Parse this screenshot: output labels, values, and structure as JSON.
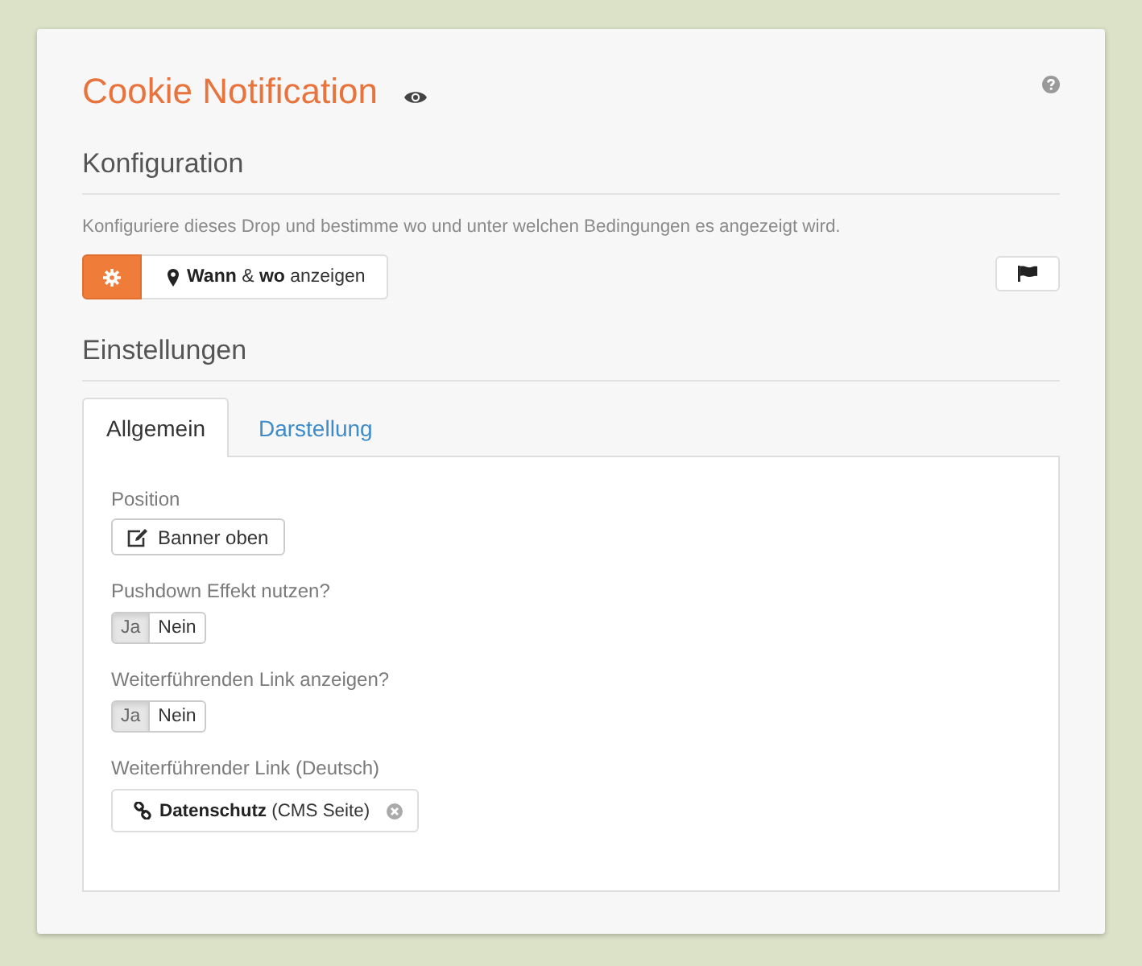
{
  "header": {
    "title": "Cookie Notification"
  },
  "configuration": {
    "heading": "Konfiguration",
    "description": "Konfiguriere dieses Drop und bestimme wo und unter welchen Bedingungen es angezeigt wird.",
    "where_button": "**Wann** & **wo** anzeigen"
  },
  "settings": {
    "heading": "Einstellungen",
    "tabs": [
      {
        "label": "Allgemein",
        "selected": true
      },
      {
        "label": "Darstellung",
        "selected": false
      }
    ],
    "fields": [
      {
        "kind": "button",
        "label": "Position",
        "value": "Banner oben"
      },
      {
        "kind": "toggle",
        "label": "Pushdown Effekt nutzen?",
        "options": [
          {
            "label": "Ja",
            "selected": true
          },
          {
            "label": "Nein",
            "selected": false
          }
        ]
      },
      {
        "kind": "toggle",
        "label": "Weiterführenden Link anzeigen?",
        "options": [
          {
            "label": "Ja",
            "selected": true
          },
          {
            "label": "Nein",
            "selected": false
          }
        ]
      },
      {
        "kind": "link",
        "label": "Weiterführender Link (Deutsch)",
        "value": "**Datenschutz** (CMS Seite)"
      }
    ]
  }
}
